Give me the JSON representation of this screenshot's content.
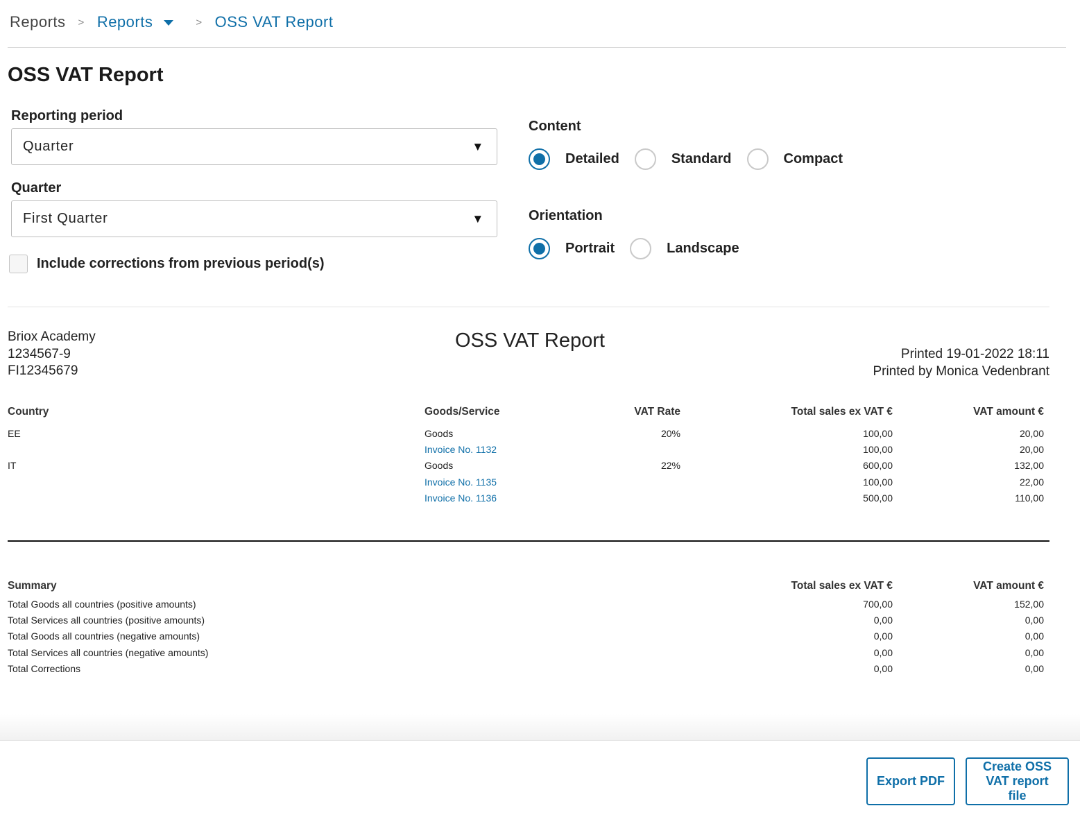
{
  "breadcrumb": {
    "root": "Reports",
    "separator": ">",
    "section": "Reports",
    "current": "OSS VAT Report"
  },
  "page_title": "OSS VAT Report",
  "form": {
    "reporting_period_label": "Reporting period",
    "reporting_period_value": "Quarter",
    "quarter_label": "Quarter",
    "quarter_value": "First Quarter",
    "dropdown_arrow": "▼",
    "include_corrections_label": "Include corrections from previous period(s)",
    "include_corrections_checked": false,
    "content_label": "Content",
    "content_options": [
      "Detailed",
      "Standard",
      "Compact"
    ],
    "content_selected": "Detailed",
    "orientation_label": "Orientation",
    "orientation_options": [
      "Portrait",
      "Landscape"
    ],
    "orientation_selected": "Portrait"
  },
  "report": {
    "company_name": "Briox Academy",
    "company_org_no": "1234567-9",
    "company_vat_no": "FI12345679",
    "title": "OSS VAT Report",
    "printed": "Printed 19-01-2022 18:11",
    "printed_by": "Printed by Monica Vedenbrant",
    "columns": {
      "country": "Country",
      "goods_service": "Goods/Service",
      "vat_rate": "VAT Rate",
      "total_sales": "Total sales ex VAT €",
      "vat_amount": "VAT amount €"
    },
    "rows": [
      {
        "country": "EE",
        "item": "Goods",
        "is_link": false,
        "vat_rate": "20%",
        "total_sales": "100,00",
        "vat_amount": "20,00"
      },
      {
        "country": "",
        "item": "Invoice No. 1132",
        "is_link": true,
        "vat_rate": "",
        "total_sales": "100,00",
        "vat_amount": "20,00"
      },
      {
        "country": "IT",
        "item": "Goods",
        "is_link": false,
        "vat_rate": "22%",
        "total_sales": "600,00",
        "vat_amount": "132,00"
      },
      {
        "country": "",
        "item": "Invoice No. 1135",
        "is_link": true,
        "vat_rate": "",
        "total_sales": "100,00",
        "vat_amount": "22,00"
      },
      {
        "country": "",
        "item": "Invoice No. 1136",
        "is_link": true,
        "vat_rate": "",
        "total_sales": "500,00",
        "vat_amount": "110,00"
      }
    ],
    "summary": {
      "heading": "Summary",
      "total_sales_header": "Total sales ex VAT €",
      "vat_amount_header": "VAT amount €",
      "rows": [
        {
          "label": "Total Goods all countries (positive amounts)",
          "total_sales": "700,00",
          "vat_amount": "152,00"
        },
        {
          "label": "Total Services all countries (positive amounts)",
          "total_sales": "0,00",
          "vat_amount": "0,00"
        },
        {
          "label": "Total Goods all countries (negative amounts)",
          "total_sales": "0,00",
          "vat_amount": "0,00"
        },
        {
          "label": "Total Services all countries (negative amounts)",
          "total_sales": "0,00",
          "vat_amount": "0,00"
        },
        {
          "label": "Total Corrections",
          "total_sales": "0,00",
          "vat_amount": "0,00"
        }
      ]
    }
  },
  "actions": {
    "export_pdf": "Export PDF",
    "create_file_line1": "Create OSS",
    "create_file_line2": "VAT report",
    "create_file_line3": "file"
  },
  "colors": {
    "accent": "#0f6fa8",
    "text": "#222222",
    "divider": "#d9d9d9"
  }
}
